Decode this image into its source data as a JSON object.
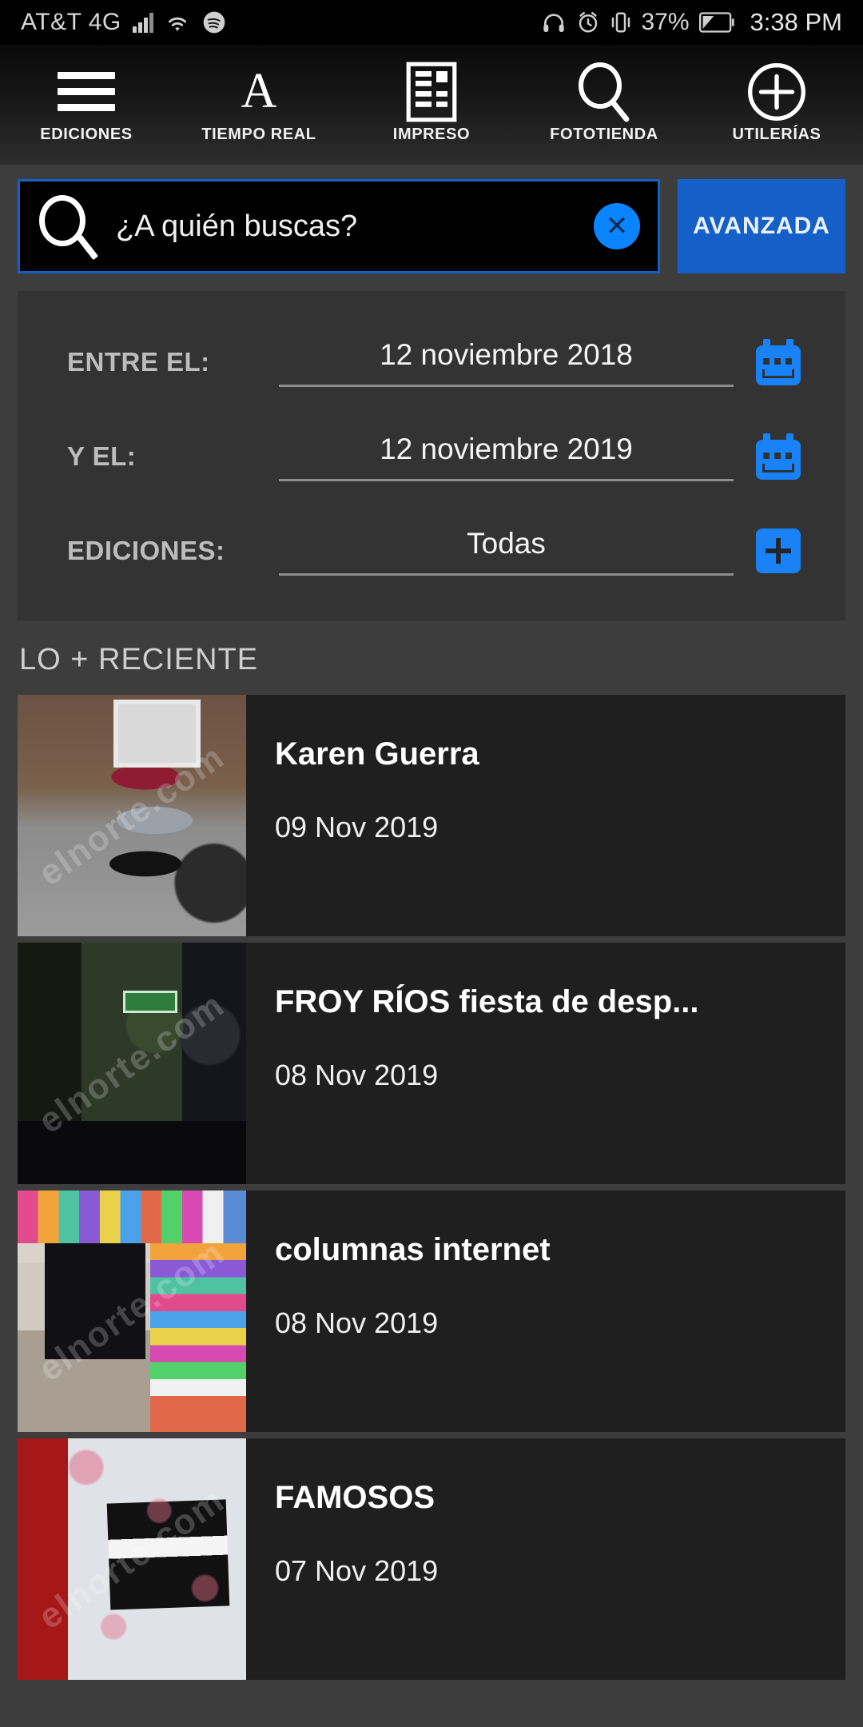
{
  "status_bar": {
    "carrier": "AT&T 4G",
    "battery_percent": "37%",
    "time": "3:38 PM",
    "icons": [
      "signal-bars-icon",
      "wifi-icon",
      "spotify-icon",
      "headphones-icon",
      "alarm-icon",
      "vibrate-icon",
      "battery-icon"
    ]
  },
  "nav": {
    "items": [
      {
        "label": "EDICIONES",
        "icon": "hamburger-menu-icon"
      },
      {
        "label": "TIEMPO REAL",
        "icon": "letter-a-icon"
      },
      {
        "label": "IMPRESO",
        "icon": "newspaper-icon"
      },
      {
        "label": "FOTOTIENDA",
        "icon": "search-icon"
      },
      {
        "label": "UTILERÍAS",
        "icon": "plus-circle-icon"
      }
    ]
  },
  "search": {
    "placeholder": "¿A quién buscas?",
    "value": "",
    "clear_label": "✕",
    "advanced_label": "AVANZADA",
    "accent_color": "#1560c8",
    "clear_color": "#0a84ff"
  },
  "filters": {
    "rows": [
      {
        "label": "ENTRE EL:",
        "value": "12 noviembre 2018",
        "icon": "calendar-icon"
      },
      {
        "label": "Y EL:",
        "value": "12 noviembre 2019",
        "icon": "calendar-icon"
      },
      {
        "label": "EDICIONES:",
        "value": "Todas",
        "icon": "plus-icon"
      }
    ]
  },
  "section": {
    "title": "LO + RECIENTE"
  },
  "list": {
    "items": [
      {
        "title": "Karen Guerra",
        "date": "09 Nov 2019",
        "watermark": "elnorte.com"
      },
      {
        "title": "FROY RÍOS fiesta de desp...",
        "date": "08 Nov 2019",
        "watermark": "elnorte.com"
      },
      {
        "title": "columnas internet",
        "date": "08 Nov 2019",
        "watermark": "elnorte.com"
      },
      {
        "title": "FAMOSOS",
        "date": "07 Nov 2019",
        "watermark": "elnorte.com"
      }
    ]
  }
}
